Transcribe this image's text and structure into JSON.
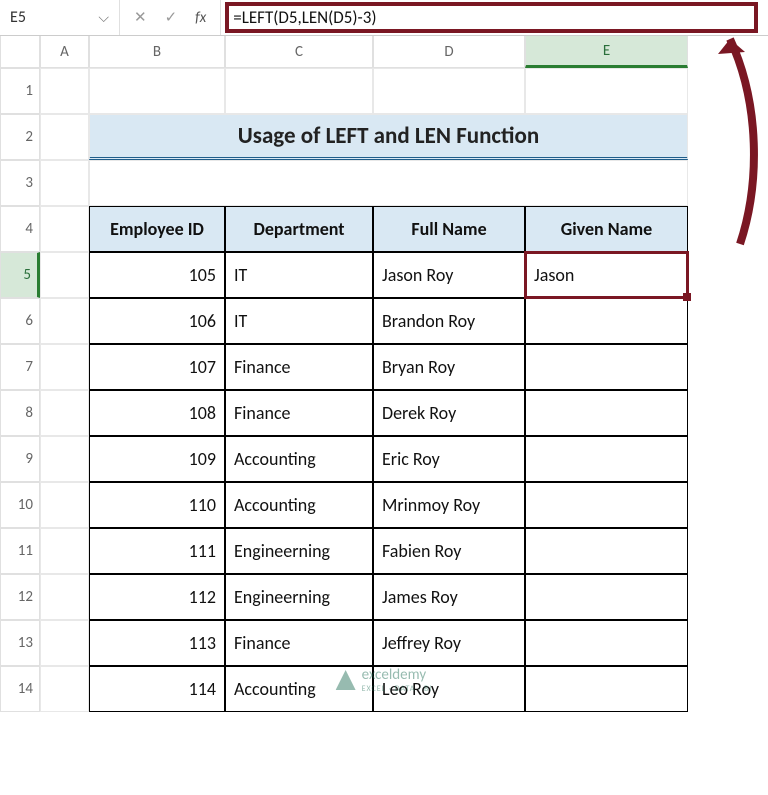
{
  "name_box": "E5",
  "formula": "=LEFT(D5,LEN(D5)-3)",
  "fx_label": "fx",
  "columns": [
    "A",
    "B",
    "C",
    "D",
    "E"
  ],
  "rows": [
    "1",
    "2",
    "3",
    "4",
    "5",
    "6",
    "7",
    "8",
    "9",
    "10",
    "11",
    "12",
    "13",
    "14"
  ],
  "title": "Usage of LEFT and LEN Function",
  "headers": {
    "emp": "Employee ID",
    "dept": "Department",
    "full": "Full Name",
    "given": "Given Name"
  },
  "table": [
    {
      "emp": "105",
      "dept": "IT",
      "full": "Jason Roy",
      "given": "Jason"
    },
    {
      "emp": "106",
      "dept": "IT",
      "full": "Brandon Roy",
      "given": ""
    },
    {
      "emp": "107",
      "dept": "Finance",
      "full": "Bryan Roy",
      "given": ""
    },
    {
      "emp": "108",
      "dept": "Finance",
      "full": "Derek Roy",
      "given": ""
    },
    {
      "emp": "109",
      "dept": "Accounting",
      "full": "Eric Roy",
      "given": ""
    },
    {
      "emp": "110",
      "dept": "Accounting",
      "full": "Mrinmoy Roy",
      "given": ""
    },
    {
      "emp": "111",
      "dept": "Engineerning",
      "full": "Fabien Roy",
      "given": ""
    },
    {
      "emp": "112",
      "dept": "Engineerning",
      "full": "James Roy",
      "given": ""
    },
    {
      "emp": "113",
      "dept": "Finance",
      "full": "Jeffrey Roy",
      "given": ""
    },
    {
      "emp": "114",
      "dept": "Accounting",
      "full": "Leo Roy",
      "given": ""
    }
  ],
  "watermark": {
    "brand": "exceldemy",
    "sub": "EXCEL · DATA · BI"
  }
}
